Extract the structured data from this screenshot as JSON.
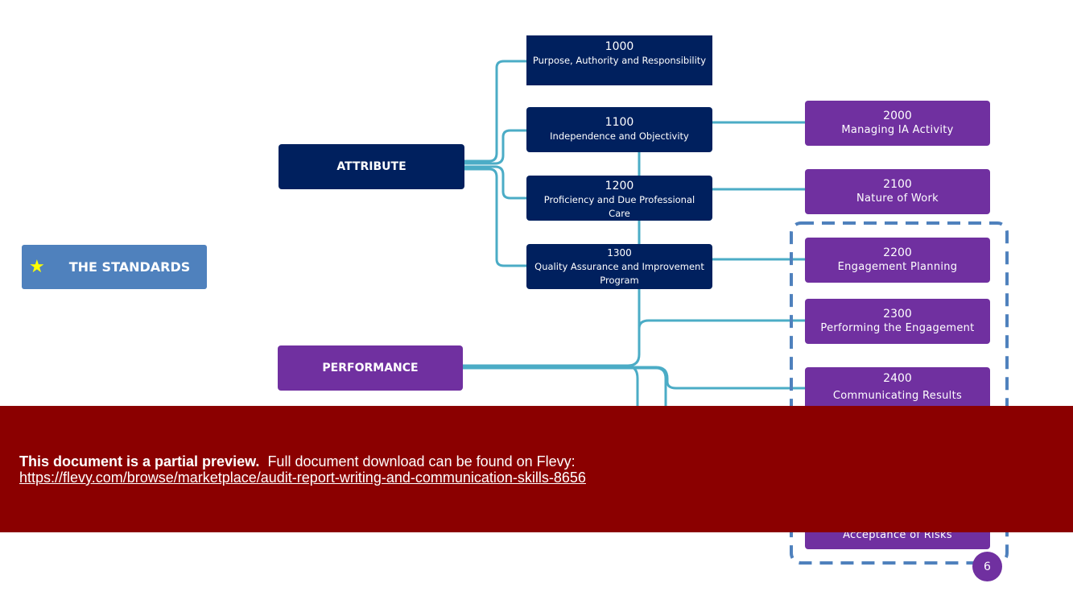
{
  "root": {
    "label": "THE STANDARDS",
    "icon": "star-icon"
  },
  "categories": {
    "attribute": "ATTRIBUTE",
    "performance": "PERFORMANCE"
  },
  "attribute_items": [
    {
      "num": "1000",
      "label": "Purpose, Authority and Responsibility"
    },
    {
      "num": "1100",
      "label": "Independence and Objectivity"
    },
    {
      "num": "1200",
      "label": "Proficiency and Due Professional Care"
    },
    {
      "num": "1300",
      "label": "Quality Assurance and Improvement Program"
    }
  ],
  "performance_items": [
    {
      "num": "2000",
      "label": "Managing IA Activity"
    },
    {
      "num": "2100",
      "label": "Nature of Work"
    },
    {
      "num": "2200",
      "label": "Engagement Planning"
    },
    {
      "num": "2300",
      "label": "Performing the Engagement"
    },
    {
      "num": "2400",
      "label": "Communicating Results"
    },
    {
      "num": "",
      "label": "Acceptance of Risks"
    }
  ],
  "page_number": "6",
  "banner": {
    "bold": "This document is a partial preview.",
    "text": "Full document download can be found on Flevy:",
    "link": "https://flevy.com/browse/marketplace/audit-report-writing-and-communication-skills-8656"
  },
  "colors": {
    "navy": "#00205e",
    "purple": "#7030a0",
    "connector": "#4bacc6",
    "standards": "#4f81bd",
    "banner": "#8b0000"
  }
}
